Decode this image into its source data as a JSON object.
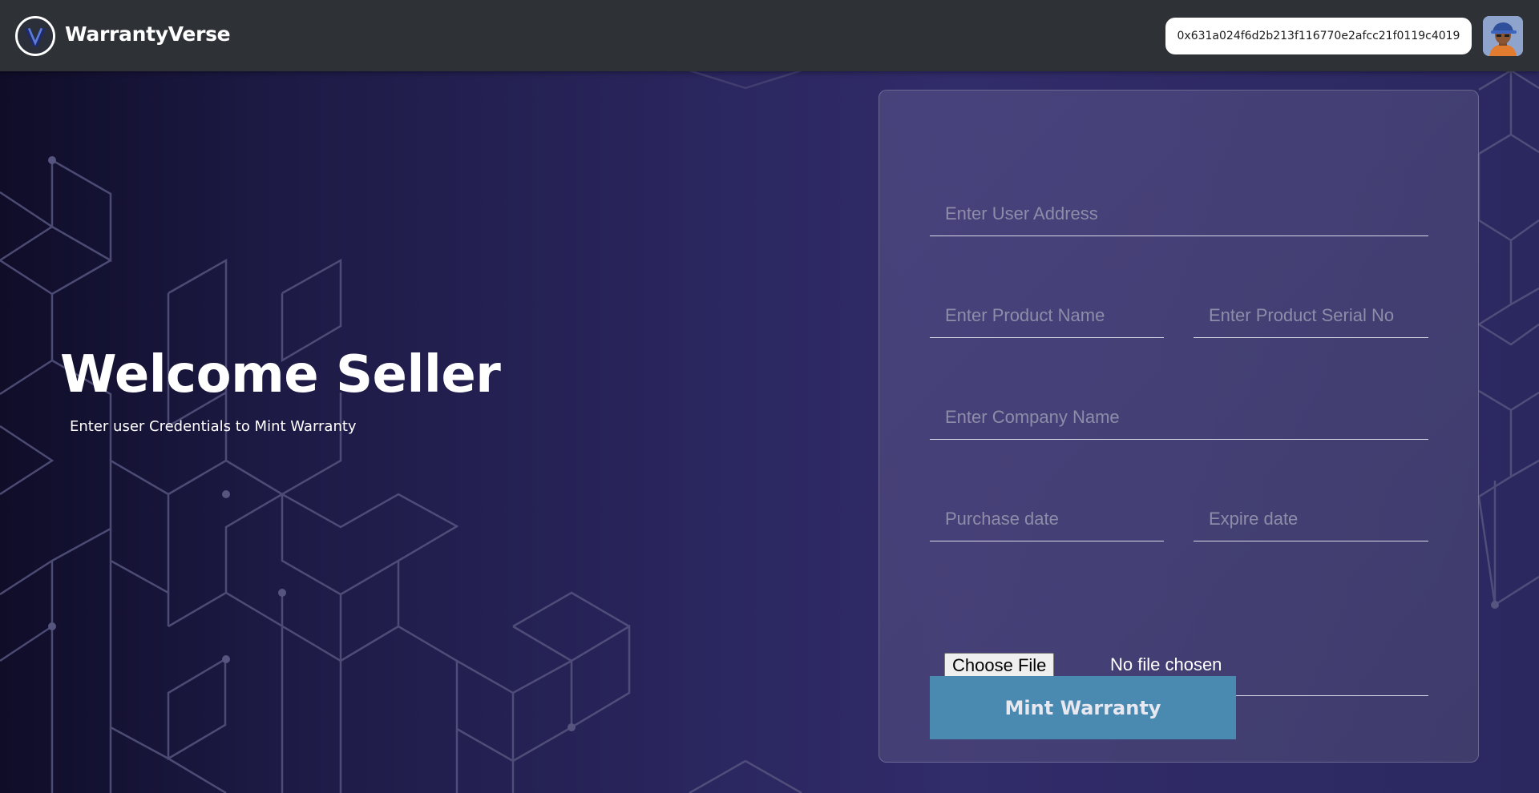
{
  "header": {
    "brand": "WarrantyVerse",
    "wallet_address": "0x631a024f6d2b213f116770e2afcc21f0119c4019"
  },
  "hero": {
    "title": "Welcome Seller",
    "subtitle": "Enter user Credentials to Mint Warranty"
  },
  "form": {
    "user_address": {
      "placeholder": "Enter User Address",
      "value": ""
    },
    "product_name": {
      "placeholder": "Enter Product Name",
      "value": ""
    },
    "product_serial": {
      "placeholder": "Enter Product Serial No",
      "value": ""
    },
    "company_name": {
      "placeholder": "Enter Company Name",
      "value": ""
    },
    "purchase_date": {
      "placeholder": "Purchase date",
      "value": ""
    },
    "expire_date": {
      "placeholder": "Expire date",
      "value": ""
    },
    "file": {
      "button_label": "Choose File",
      "status": "No file chosen"
    },
    "submit_label": "Mint Warranty"
  },
  "colors": {
    "header_bg": "#2e3136",
    "accent_button": "#4a89b0",
    "background_dark": "#0f0d28",
    "background_mid": "#2a265e"
  },
  "icons": {
    "logo": "warrantyverse-logo-icon",
    "avatar": "user-avatar-icon"
  }
}
